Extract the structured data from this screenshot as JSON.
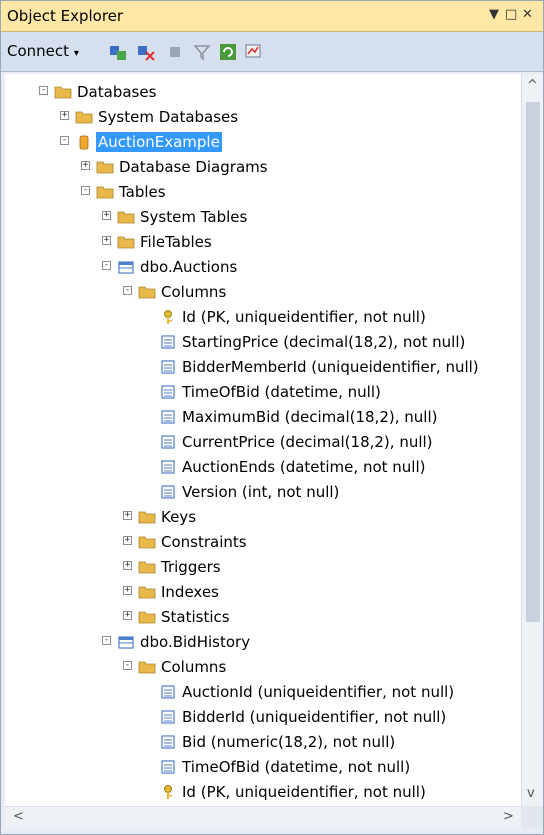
{
  "window": {
    "title": "Object Explorer"
  },
  "titlebar_icons": [
    "pin-dropdown-icon",
    "maximize-icon",
    "close-icon"
  ],
  "toolbar": {
    "connect_label": "Connect",
    "icons": [
      "connect-object-explorer-icon",
      "disconnect-icon",
      "stop-icon",
      "filter-icon",
      "refresh-icon",
      "activity-monitor-icon"
    ]
  },
  "tree": [
    {
      "label": "Databases",
      "level": 0,
      "expander": "-",
      "icon": "folder-icon"
    },
    {
      "label": "System Databases",
      "level": 1,
      "expander": "+",
      "icon": "folder-icon"
    },
    {
      "label": "AuctionExample",
      "level": 1,
      "expander": "-",
      "icon": "database-icon",
      "selected": true
    },
    {
      "label": "Database Diagrams",
      "level": 2,
      "expander": "+",
      "icon": "folder-icon"
    },
    {
      "label": "Tables",
      "level": 2,
      "expander": "-",
      "icon": "folder-icon"
    },
    {
      "label": "System Tables",
      "level": 3,
      "expander": "+",
      "icon": "folder-icon"
    },
    {
      "label": "FileTables",
      "level": 3,
      "expander": "+",
      "icon": "folder-icon"
    },
    {
      "label": "dbo.Auctions",
      "level": 3,
      "expander": "-",
      "icon": "table-icon"
    },
    {
      "label": "Columns",
      "level": 4,
      "expander": "-",
      "icon": "folder-icon"
    },
    {
      "label": "Id (PK, uniqueidentifier, not null)",
      "level": 5,
      "expander": "",
      "icon": "primary-key-icon"
    },
    {
      "label": "StartingPrice (decimal(18,2), not null)",
      "level": 5,
      "expander": "",
      "icon": "column-icon"
    },
    {
      "label": "BidderMemberId (uniqueidentifier, null)",
      "level": 5,
      "expander": "",
      "icon": "column-icon"
    },
    {
      "label": "TimeOfBid (datetime, null)",
      "level": 5,
      "expander": "",
      "icon": "column-icon"
    },
    {
      "label": "MaximumBid (decimal(18,2), null)",
      "level": 5,
      "expander": "",
      "icon": "column-icon"
    },
    {
      "label": "CurrentPrice (decimal(18,2), null)",
      "level": 5,
      "expander": "",
      "icon": "column-icon"
    },
    {
      "label": "AuctionEnds (datetime, not null)",
      "level": 5,
      "expander": "",
      "icon": "column-icon"
    },
    {
      "label": "Version (int, not null)",
      "level": 5,
      "expander": "",
      "icon": "column-icon"
    },
    {
      "label": "Keys",
      "level": 4,
      "expander": "+",
      "icon": "folder-icon"
    },
    {
      "label": "Constraints",
      "level": 4,
      "expander": "+",
      "icon": "folder-icon"
    },
    {
      "label": "Triggers",
      "level": 4,
      "expander": "+",
      "icon": "folder-icon"
    },
    {
      "label": "Indexes",
      "level": 4,
      "expander": "+",
      "icon": "folder-icon"
    },
    {
      "label": "Statistics",
      "level": 4,
      "expander": "+",
      "icon": "folder-icon"
    },
    {
      "label": "dbo.BidHistory",
      "level": 3,
      "expander": "-",
      "icon": "table-icon"
    },
    {
      "label": "Columns",
      "level": 4,
      "expander": "-",
      "icon": "folder-icon"
    },
    {
      "label": "AuctionId (uniqueidentifier, not null)",
      "level": 5,
      "expander": "",
      "icon": "column-icon"
    },
    {
      "label": "BidderId (uniqueidentifier, not null)",
      "level": 5,
      "expander": "",
      "icon": "column-icon"
    },
    {
      "label": "Bid (numeric(18,2), not null)",
      "level": 5,
      "expander": "",
      "icon": "column-icon"
    },
    {
      "label": "TimeOfBid (datetime, not null)",
      "level": 5,
      "expander": "",
      "icon": "column-icon"
    },
    {
      "label": "Id (PK, uniqueidentifier, not null)",
      "level": 5,
      "expander": "",
      "icon": "primary-key-icon"
    }
  ],
  "colors": {
    "titlebar": "#ffe8a6",
    "toolbar": "#d6dfee",
    "selection": "#3399ff",
    "folder": "#e8b94a",
    "database": "#f0a830",
    "table": "#4f7fc8"
  }
}
